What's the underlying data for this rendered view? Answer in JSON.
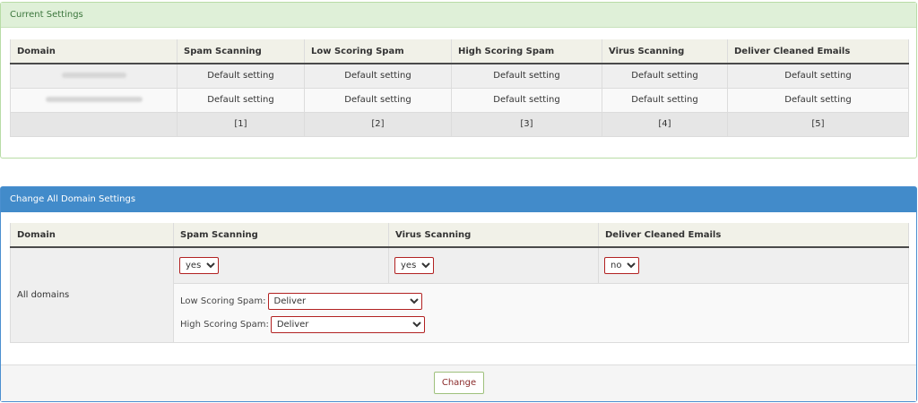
{
  "current_settings": {
    "title": "Current Settings",
    "headers": [
      "Domain",
      "Spam Scanning",
      "Low Scoring Spam",
      "High Scoring Spam",
      "Virus Scanning",
      "Deliver Cleaned Emails"
    ],
    "rows": [
      [
        "Default setting",
        "Default setting",
        "Default setting",
        "Default setting",
        "Default setting"
      ],
      [
        "Default setting",
        "Default setting",
        "Default setting",
        "Default setting",
        "Default setting"
      ]
    ],
    "notes": [
      "[1]",
      "[2]",
      "[3]",
      "[4]",
      "[5]"
    ]
  },
  "change_settings": {
    "title": "Change All Domain Settings",
    "headers": [
      "Domain",
      "Spam Scanning",
      "Virus Scanning",
      "Deliver Cleaned Emails"
    ],
    "domain_label": "All domains",
    "spam_scanning": "yes",
    "virus_scanning": "yes",
    "deliver_cleaned": "no",
    "low_scoring_label": "Low Scoring Spam:",
    "low_scoring_value": "Deliver",
    "high_scoring_label": "High Scoring Spam:",
    "high_scoring_value": "Deliver",
    "button": "Change"
  }
}
